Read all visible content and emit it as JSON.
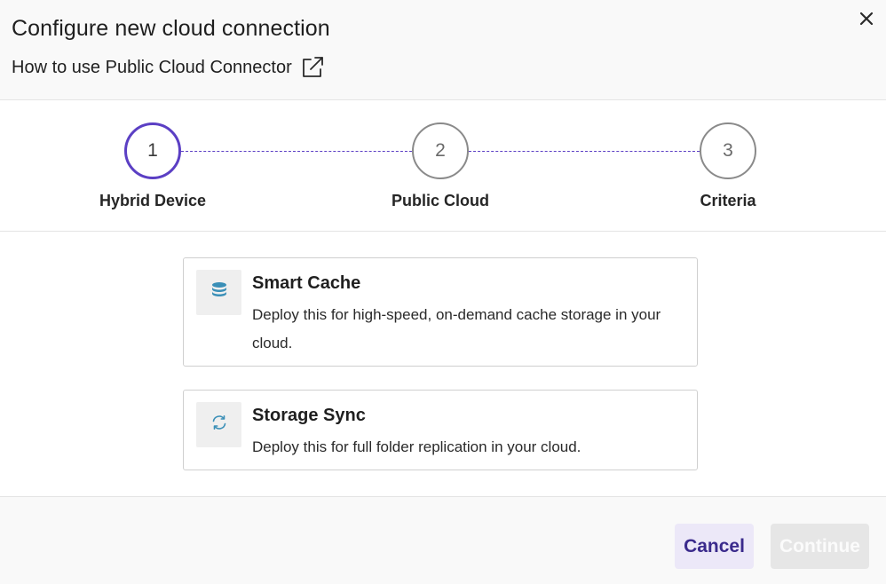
{
  "dialog": {
    "title": "Configure new cloud connection",
    "help_link": "How to use Public Cloud Connector"
  },
  "stepper": {
    "steps": [
      {
        "number": "1",
        "label": "Hybrid Device",
        "state": "active"
      },
      {
        "number": "2",
        "label": "Public Cloud",
        "state": "pending"
      },
      {
        "number": "3",
        "label": "Criteria",
        "state": "pending"
      }
    ]
  },
  "options": [
    {
      "icon": "database-icon",
      "title": "Smart Cache",
      "description": "Deploy this for high-speed, on-demand cache storage in your cloud."
    },
    {
      "icon": "sync-icon",
      "title": "Storage Sync",
      "description": "Deploy this for full folder replication in your cloud."
    }
  ],
  "footer": {
    "cancel_label": "Cancel",
    "continue_label": "Continue"
  },
  "colors": {
    "accent": "#5b3fc4",
    "icon_blue": "#3a8fb7",
    "cancel_bg": "#ece8f8",
    "cancel_text": "#3a2a8c",
    "disabled_bg": "#e6e6e6"
  }
}
